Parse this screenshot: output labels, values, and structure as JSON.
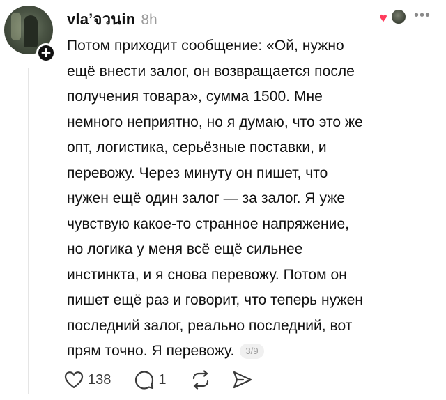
{
  "post": {
    "username": "vla’จวนin",
    "timestamp": "8h",
    "more_menu_label": "•••",
    "text_lines": [
      "Потом приходит сообщение: «Ой, нужно",
      "ещё внести залог, он возвращается после",
      "получения товара», сумма 1500. Мне",
      "немного неприятно, но я думаю, что это же",
      "опт, логистика, серьёзные поставки, и",
      "перевожу. Через минуту он пишет, что",
      "нужен ещё один залог — за залог. Я уже",
      "чувствую какое-то странное напряжение,",
      "но логика у меня всё ещё сильнее",
      "инстинкта, и я снова перевожу. Потом он",
      "пишет ещё раз и говорит, что теперь нужен",
      "последний залог, реально последний, вот",
      "прям точно. Я перевожу."
    ],
    "page_indicator": "3/9",
    "follow_badge": "+",
    "heart_glyph": "♥",
    "accent_color": "#ff3b5c"
  },
  "actions": {
    "like_icon": "heart-outline-icon",
    "like_count": "138",
    "reply_icon": "speech-bubble-icon",
    "reply_count": "1",
    "repost_icon": "repost-arrows-icon",
    "share_icon": "send-arrow-icon"
  }
}
